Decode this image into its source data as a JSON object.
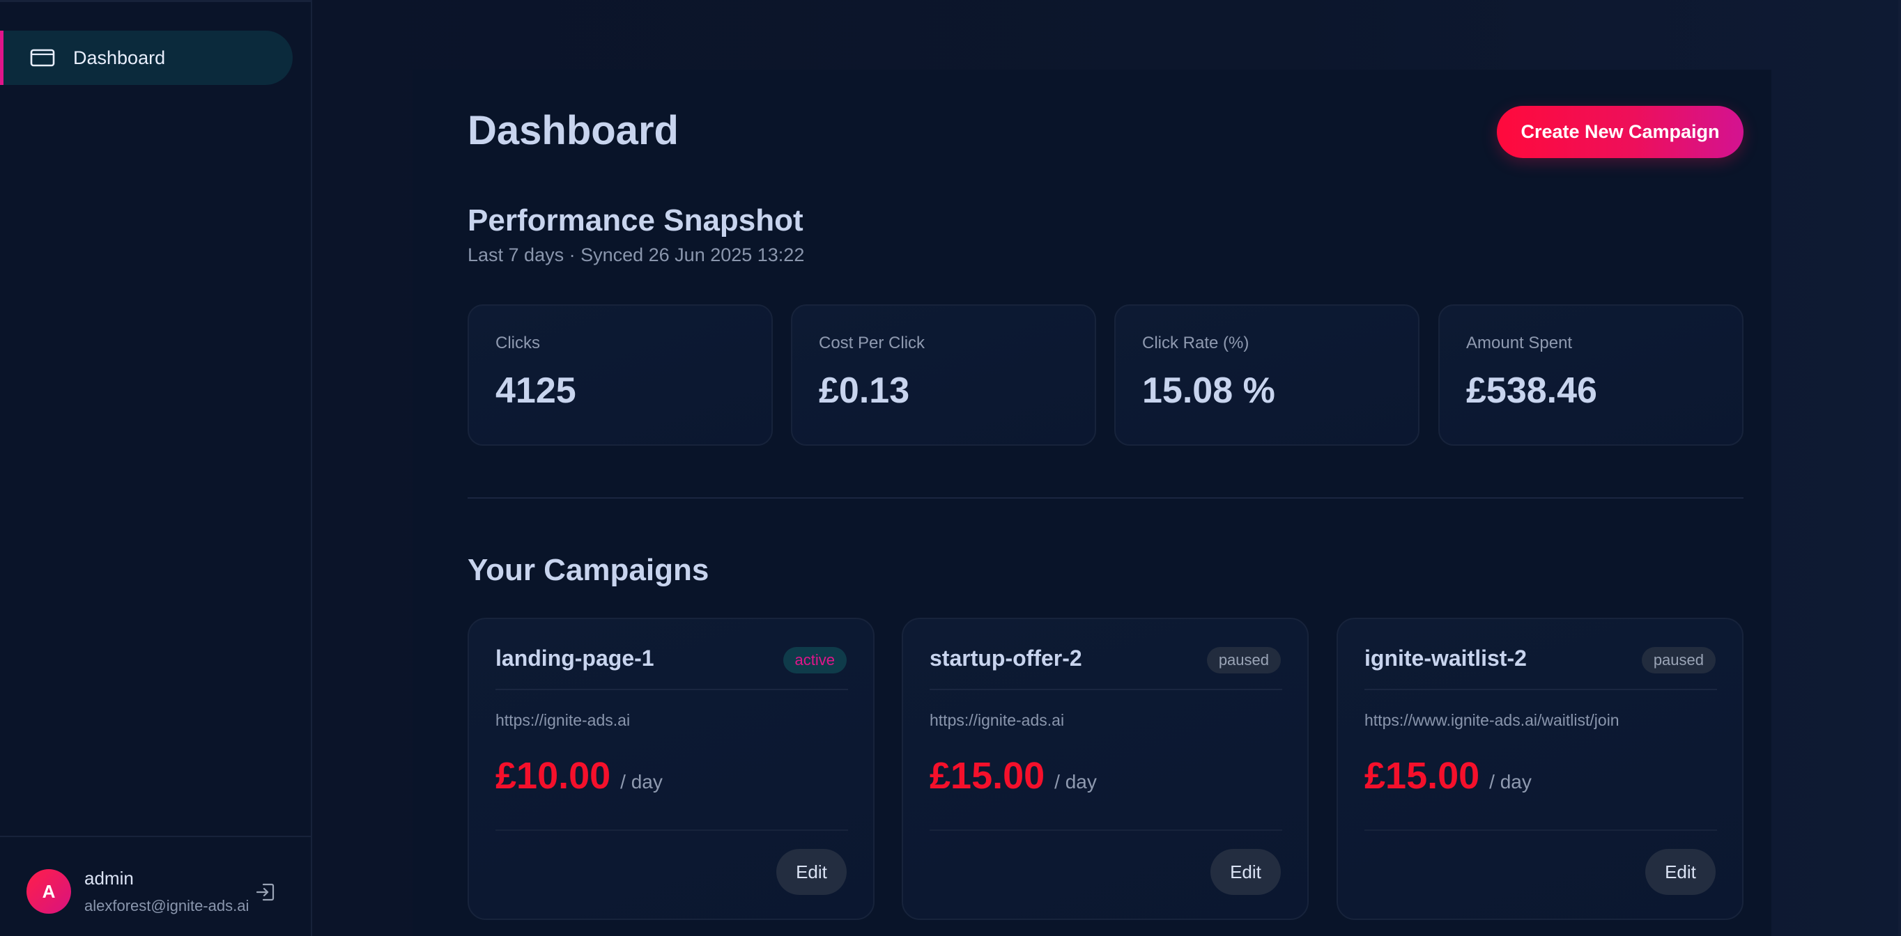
{
  "sidebar": {
    "items": [
      {
        "label": "Dashboard",
        "icon": "monitor-icon",
        "active": true
      }
    ],
    "user": {
      "avatar_initial": "A",
      "name": "admin",
      "email": "alexforest@ignite-ads.ai"
    }
  },
  "header": {
    "title": "Dashboard",
    "create_button_label": "Create New Campaign"
  },
  "snapshot": {
    "title": "Performance Snapshot",
    "subtitle": "Last 7 days · Synced 26 Jun 2025 13:22",
    "stats": [
      {
        "label": "Clicks",
        "value": "4125"
      },
      {
        "label": "Cost Per Click",
        "value": "£0.13"
      },
      {
        "label": "Click Rate (%)",
        "value": "15.08 %"
      },
      {
        "label": "Amount Spent",
        "value": "£538.46"
      }
    ]
  },
  "campaigns": {
    "title": "Your Campaigns",
    "edit_label": "Edit",
    "budget_unit": "/ day",
    "items": [
      {
        "name": "landing-page-1",
        "status": "active",
        "url": "https://ignite-ads.ai",
        "budget": "£10.00"
      },
      {
        "name": "startup-offer-2",
        "status": "paused",
        "url": "https://ignite-ads.ai",
        "budget": "£15.00"
      },
      {
        "name": "ignite-waitlist-2",
        "status": "paused",
        "url": "https://www.ignite-ads.ai/waitlist/join",
        "budget": "£15.00"
      }
    ]
  },
  "colors": {
    "accent_pink": "#e0158a",
    "cta_red": "#ff0a3c",
    "budget_red": "#f5102b",
    "background": "#0b1429"
  }
}
